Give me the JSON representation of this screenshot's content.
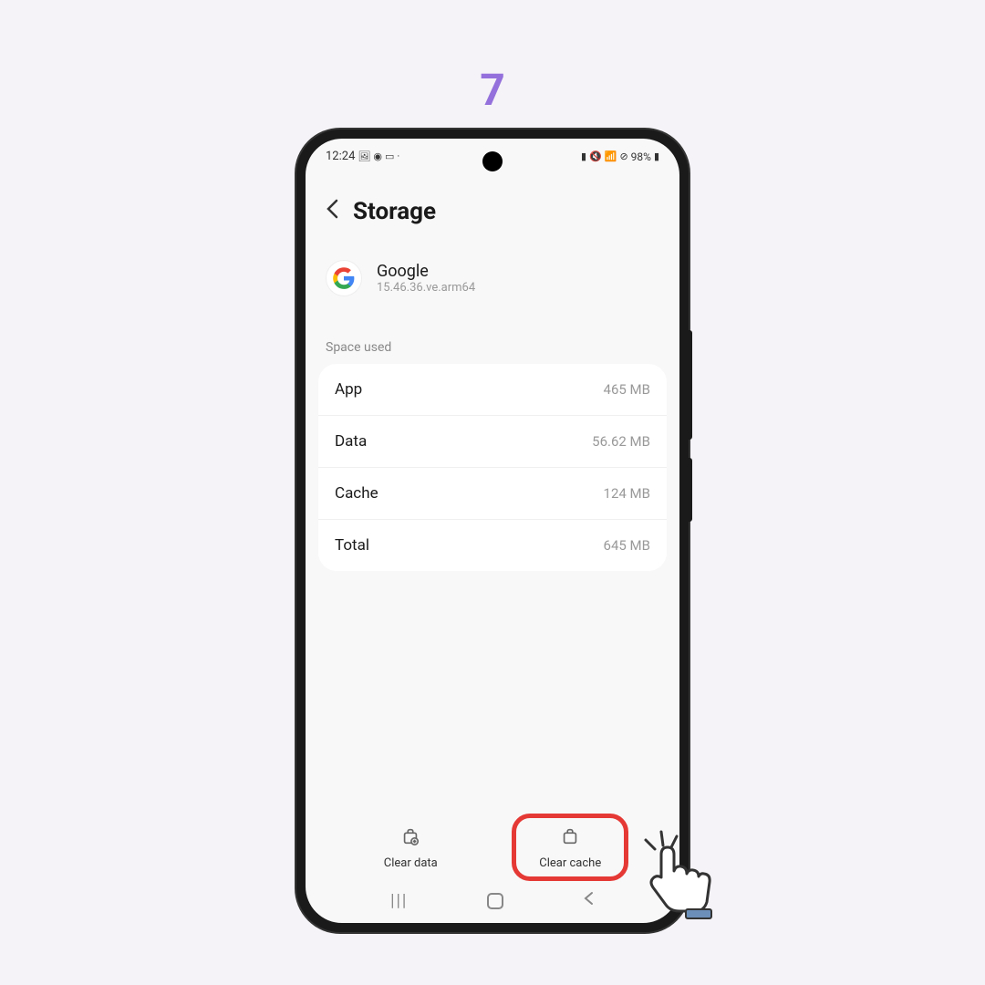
{
  "step": "7",
  "statusBar": {
    "time": "12:24",
    "battery": "98%"
  },
  "header": {
    "title": "Storage"
  },
  "app": {
    "name": "Google",
    "version": "15.46.36.ve.arm64"
  },
  "section": {
    "label": "Space used"
  },
  "storage": {
    "rows": [
      {
        "label": "App",
        "value": "465 MB"
      },
      {
        "label": "Data",
        "value": "56.62 MB"
      },
      {
        "label": "Cache",
        "value": "124 MB"
      },
      {
        "label": "Total",
        "value": "645 MB"
      }
    ]
  },
  "actions": {
    "clearData": "Clear data",
    "clearCache": "Clear cache"
  }
}
